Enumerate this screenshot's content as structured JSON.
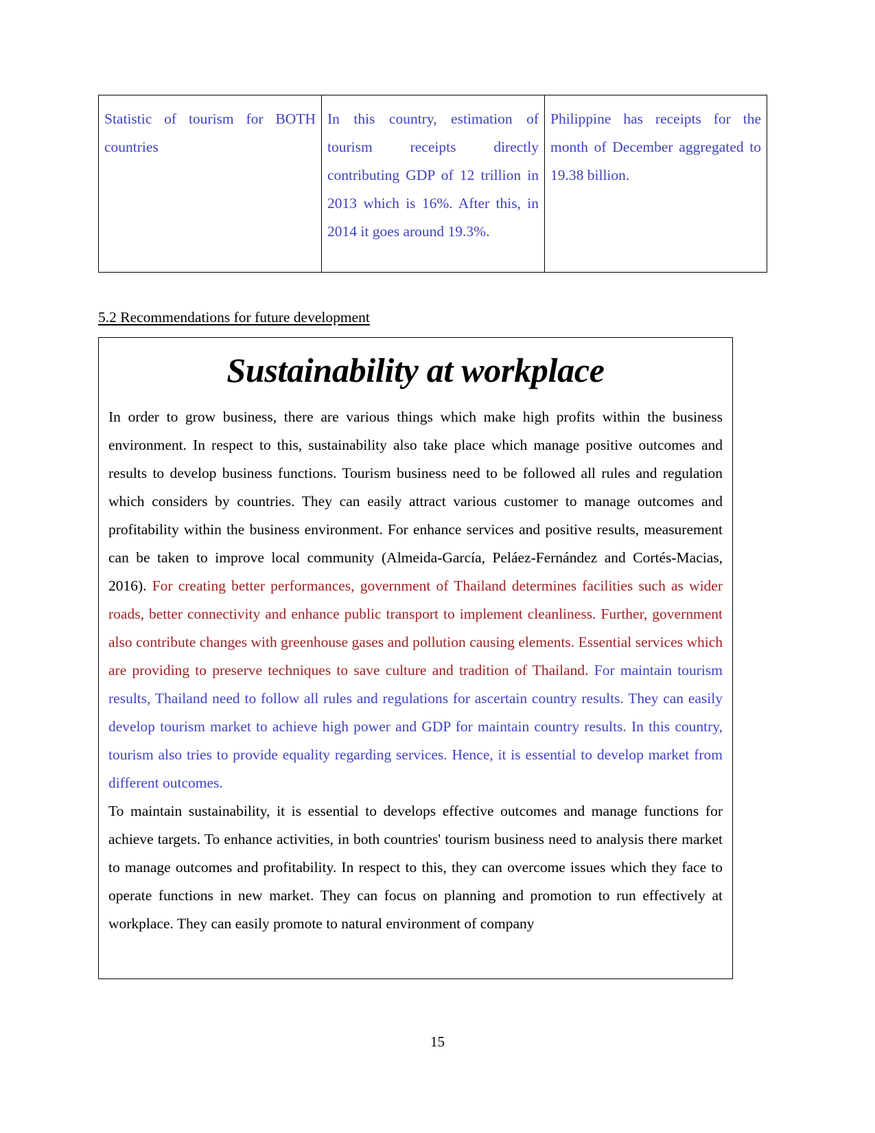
{
  "document": {
    "page_number": "15",
    "colors": {
      "blue_text": "#4141c8",
      "red_text": "#9e2021",
      "black_text": "#000000",
      "border": "#000000"
    }
  },
  "table": {
    "rows": [
      {
        "col1": "Statistic of tourism for BOTH countries",
        "col2": "In this country, estimation of tourism receipts directly contributing GDP of 12 trillion in 2013 which is 16%. After this, in 2014 it goes around 19.3%.",
        "col3": "Philippine has receipts for the month of December aggregated to 19.38 billion."
      }
    ]
  },
  "section": {
    "heading": "5.2 Recommendations for future development"
  },
  "textbox": {
    "title": "Sustainability at workplace",
    "paragraph1": {
      "black_part_1": "In order to grow business, there are various things which make high profits within the business environment. In respect to this, sustainability also take place which manage positive outcomes and results to develop business functions. Tourism business need to be followed all rules and regulation which considers by countries. They can easily attract various customer to manage outcomes and profitability within the business environment. For enhance services and positive results, measurement can be taken to improve local community  (Almeida-García, Peláez-Fernández and Cortés-Macias, 2016). ",
      "red_part": "For creating better performances, government of Thailand determines facilities such as wider roads, better connectivity and enhance public transport to implement cleanliness. Further, government also contribute changes with greenhouse gases and pollution causing elements. Essential services which are providing to preserve techniques to save culture and tradition of Thailand. ",
      "blue_part": "For maintain tourism results, Thailand need to follow all rules and regulations for ascertain country results. They can easily develop tourism market to achieve high power and GDP for maintain country results. In this country, tourism also tries to provide equality regarding services. Hence, it is essential to develop market from different outcomes."
    },
    "paragraph2": "To maintain sustainability, it is essential to develops effective outcomes and manage functions for achieve targets. To enhance activities, in both countries' tourism business need to analysis there market to manage outcomes and profitability. In respect to this, they can overcome issues which they face to operate functions in new market. They can focus on planning and promotion to run effectively at workplace. They can easily promote to natural environment of company"
  }
}
